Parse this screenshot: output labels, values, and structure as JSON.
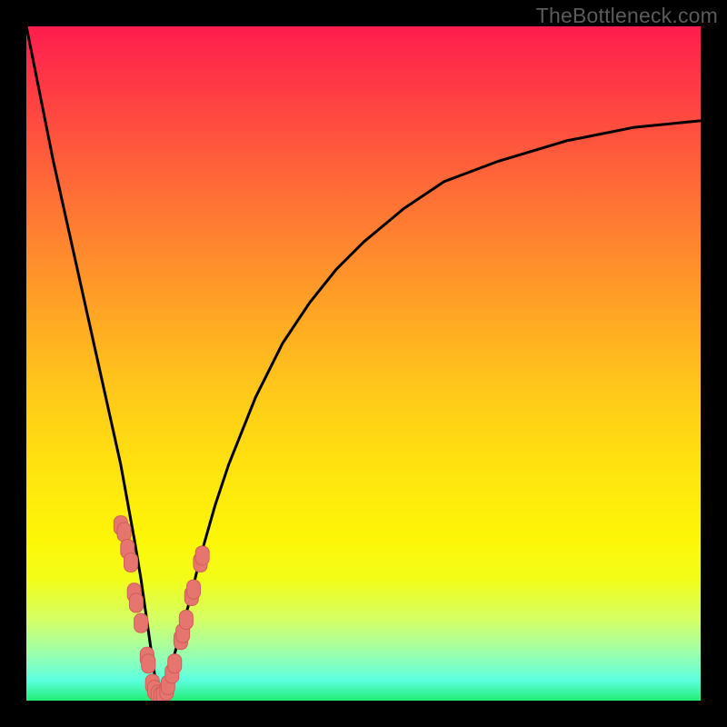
{
  "watermark": "TheBottleneck.com",
  "colors": {
    "background": "#000000",
    "curve": "#000000",
    "marker_fill": "#e6746f",
    "marker_stroke": "#cf5e59"
  },
  "chart_data": {
    "type": "line",
    "title": "",
    "xlabel": "",
    "ylabel": "",
    "xlim": [
      0,
      100
    ],
    "ylim": [
      0,
      100
    ],
    "series": [
      {
        "name": "bottleneck-curve",
        "x": [
          0,
          2,
          4,
          6,
          8,
          10,
          12,
          14,
          16,
          17,
          18,
          19,
          20,
          21,
          22,
          24,
          26,
          28,
          30,
          34,
          38,
          42,
          46,
          50,
          56,
          62,
          70,
          80,
          90,
          100
        ],
        "y": [
          100,
          90,
          80,
          71,
          62,
          53,
          44,
          35,
          24,
          18,
          11,
          4,
          0,
          3,
          7,
          14,
          22,
          29,
          35,
          45,
          53,
          59,
          64,
          68,
          73,
          77,
          80,
          83,
          85,
          86
        ]
      }
    ],
    "markers": [
      {
        "x": 14.0,
        "y": 26.0
      },
      {
        "x": 14.5,
        "y": 25.0
      },
      {
        "x": 15.0,
        "y": 22.5
      },
      {
        "x": 15.5,
        "y": 20.5
      },
      {
        "x": 16.0,
        "y": 16.0
      },
      {
        "x": 16.3,
        "y": 14.5
      },
      {
        "x": 17.0,
        "y": 11.5
      },
      {
        "x": 17.9,
        "y": 6.5
      },
      {
        "x": 18.1,
        "y": 5.5
      },
      {
        "x": 18.7,
        "y": 2.5
      },
      {
        "x": 19.0,
        "y": 1.6
      },
      {
        "x": 19.5,
        "y": 0.9
      },
      {
        "x": 19.9,
        "y": 0.6
      },
      {
        "x": 20.3,
        "y": 0.8
      },
      {
        "x": 20.8,
        "y": 1.5
      },
      {
        "x": 21.0,
        "y": 2.3
      },
      {
        "x": 21.6,
        "y": 4.0
      },
      {
        "x": 22.0,
        "y": 5.5
      },
      {
        "x": 22.9,
        "y": 9.0
      },
      {
        "x": 23.2,
        "y": 10.0
      },
      {
        "x": 23.7,
        "y": 12.0
      },
      {
        "x": 24.5,
        "y": 15.5
      },
      {
        "x": 24.8,
        "y": 16.5
      },
      {
        "x": 25.8,
        "y": 20.5
      },
      {
        "x": 26.1,
        "y": 21.5
      }
    ]
  }
}
